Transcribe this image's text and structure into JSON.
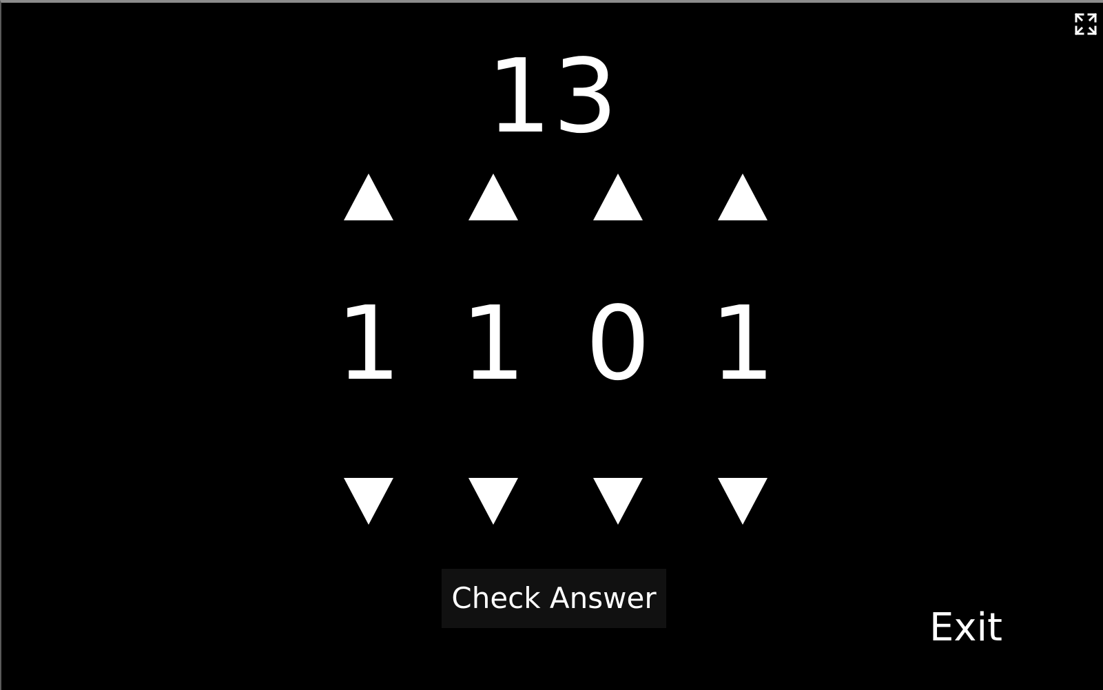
{
  "game": {
    "target_number": "13",
    "bits": [
      "1",
      "1",
      "0",
      "1"
    ]
  },
  "controls": {
    "check_label": "Check Answer",
    "exit_label": "Exit"
  },
  "icons": {
    "fullscreen": "fullscreen-toggle-icon",
    "increment": "triangle-up-icon",
    "decrement": "triangle-down-icon"
  },
  "colors": {
    "background": "#000000",
    "foreground": "#ffffff",
    "button_background": "#111111"
  }
}
